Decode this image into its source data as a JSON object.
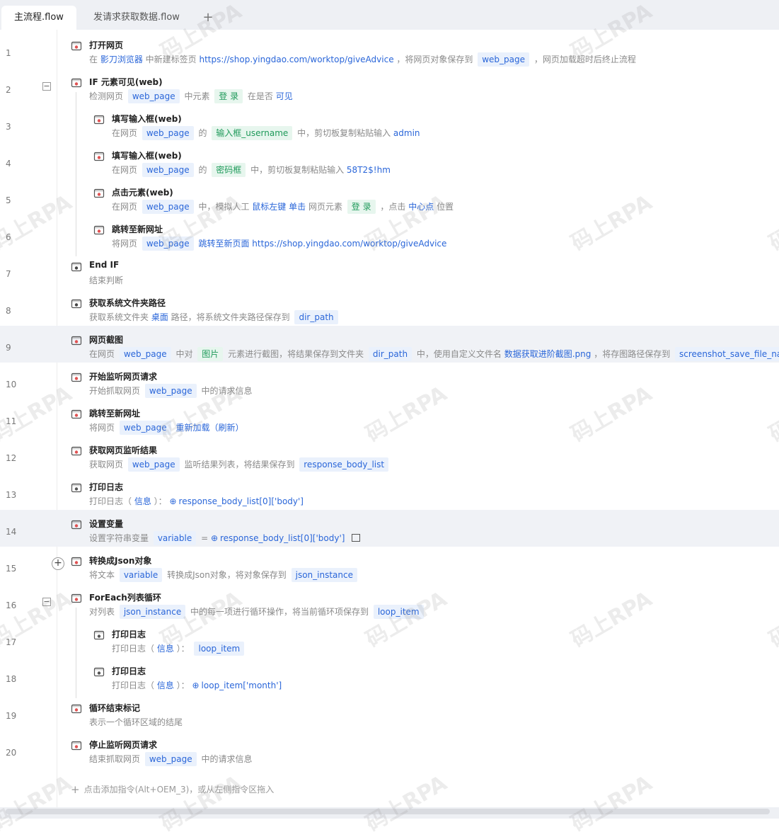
{
  "tabs": [
    {
      "label": "主流程.flow",
      "active": true
    },
    {
      "label": "发请求获取数据.flow",
      "active": false
    }
  ],
  "tab_add": "+",
  "rows": [
    {
      "num": "1",
      "title": "打开网页",
      "desc": [
        {
          "t": "在 "
        },
        {
          "v": "影刀浏览器"
        },
        {
          "t": " 中新建标签页 "
        },
        {
          "v": "https://shop.yingdao.com/worktop/giveAdvice"
        },
        {
          "t": " ，将网页对象保存到 "
        },
        {
          "pill": "web_page"
        },
        {
          "t": " ，网页加载超时后终止流程"
        }
      ]
    },
    {
      "num": "2",
      "title": "IF 元素可见(web)",
      "desc": [
        {
          "t": "检测网页 "
        },
        {
          "pill": "web_page"
        },
        {
          "t": " 中元素 "
        },
        {
          "pillg": "登 录"
        },
        {
          "t": " 在是否 "
        },
        {
          "v": "可见"
        }
      ]
    },
    {
      "num": "3",
      "title": "填写输入框(web)",
      "desc": [
        {
          "t": "在网页 "
        },
        {
          "pill": "web_page"
        },
        {
          "t": " 的 "
        },
        {
          "pillg": "输入框_username"
        },
        {
          "t": " 中，剪切板复制粘贴输入 "
        },
        {
          "v": "admin"
        }
      ]
    },
    {
      "num": "4",
      "title": "填写输入框(web)",
      "desc": [
        {
          "t": "在网页 "
        },
        {
          "pill": "web_page"
        },
        {
          "t": " 的 "
        },
        {
          "pillg": "密码框"
        },
        {
          "t": " 中，剪切板复制粘贴输入 "
        },
        {
          "v": "58T2$!hm"
        }
      ]
    },
    {
      "num": "5",
      "title": "点击元素(web)",
      "desc": [
        {
          "t": "在网页 "
        },
        {
          "pill": "web_page"
        },
        {
          "t": " 中，模拟人工 "
        },
        {
          "v": "鼠标左键"
        },
        {
          "t": " "
        },
        {
          "v": "单击"
        },
        {
          "t": " 网页元素 "
        },
        {
          "pillg": "登 录"
        },
        {
          "t": " ，点击 "
        },
        {
          "v": "中心点"
        },
        {
          "t": " 位置"
        }
      ]
    },
    {
      "num": "6",
      "title": "跳转至新网址",
      "desc": [
        {
          "t": "将网页 "
        },
        {
          "pill": "web_page"
        },
        {
          "t": " "
        },
        {
          "v": "跳转至新页面"
        },
        {
          "t": " "
        },
        {
          "v": "https://shop.yingdao.com/worktop/giveAdvice"
        }
      ]
    },
    {
      "num": "7",
      "title": "End IF",
      "desc": [
        {
          "t": "结束判断"
        }
      ]
    },
    {
      "num": "8",
      "title": "获取系统文件夹路径",
      "desc": [
        {
          "t": "获取系统文件夹 "
        },
        {
          "v": "桌面"
        },
        {
          "t": " 路径，将系统文件夹路径保存到 "
        },
        {
          "pill": "dir_path"
        }
      ]
    },
    {
      "num": "9",
      "title": "网页截图",
      "desc": [
        {
          "t": "在网页 "
        },
        {
          "pill": "web_page"
        },
        {
          "t": " 中对 "
        },
        {
          "pillg": "图片"
        },
        {
          "t": " 元素进行截图，将结果保存到文件夹 "
        },
        {
          "pill": "dir_path"
        },
        {
          "t": " 中，使用自定义文件名 "
        },
        {
          "v": "数据获取进阶截图.png"
        },
        {
          "t": " ，将存图路径保存到 "
        },
        {
          "pill": "screenshot_save_file_name"
        }
      ]
    },
    {
      "num": "10",
      "title": "开始监听网页请求",
      "desc": [
        {
          "t": "开始抓取网页 "
        },
        {
          "pill": "web_page"
        },
        {
          "t": " 中的请求信息"
        }
      ]
    },
    {
      "num": "11",
      "title": "跳转至新网址",
      "desc": [
        {
          "t": "将网页 "
        },
        {
          "pill": "web_page"
        },
        {
          "t": " "
        },
        {
          "v": "重新加载（刷新）"
        }
      ]
    },
    {
      "num": "12",
      "title": "获取网页监听结果",
      "desc": [
        {
          "t": "获取网页 "
        },
        {
          "pill": "web_page"
        },
        {
          "t": " 监听结果列表，将结果保存到 "
        },
        {
          "pill": "response_body_list"
        }
      ]
    },
    {
      "num": "13",
      "title": "打印日志",
      "desc": [
        {
          "t": "打印日志（ "
        },
        {
          "v": "信息"
        },
        {
          "t": " ）： "
        },
        {
          "expr": "response_body_list[0]['body']"
        }
      ]
    },
    {
      "num": "14",
      "title": "设置变量",
      "desc": [
        {
          "t": "设置字符串变量 "
        },
        {
          "pill": "variable"
        },
        {
          "t": " = "
        },
        {
          "expr": "response_body_list[0]['body']"
        },
        {
          "memo": ""
        }
      ]
    },
    {
      "num": "15",
      "title": "转换成Json对象",
      "desc": [
        {
          "t": "将文本 "
        },
        {
          "pill": "variable"
        },
        {
          "t": " 转换成Json对象，将对象保存到 "
        },
        {
          "pill": "json_instance"
        }
      ]
    },
    {
      "num": "16",
      "title": "ForEach列表循环",
      "desc": [
        {
          "t": "对列表 "
        },
        {
          "pill": "json_instance"
        },
        {
          "t": " 中的每一项进行循环操作，将当前循环项保存到 "
        },
        {
          "pill": "loop_item"
        }
      ]
    },
    {
      "num": "17",
      "title": "打印日志",
      "desc": [
        {
          "t": "打印日志（ "
        },
        {
          "v": "信息"
        },
        {
          "t": " ）： "
        },
        {
          "pill": "loop_item"
        }
      ]
    },
    {
      "num": "18",
      "title": "打印日志",
      "desc": [
        {
          "t": "打印日志（ "
        },
        {
          "v": "信息"
        },
        {
          "t": " ）： "
        },
        {
          "expr": "loop_item['month']"
        }
      ]
    },
    {
      "num": "19",
      "title": "循环结束标记",
      "desc": [
        {
          "t": "表示一个循环区域的结尾"
        }
      ]
    },
    {
      "num": "20",
      "title": "停止监听网页请求",
      "desc": [
        {
          "t": "结束抓取网页 "
        },
        {
          "pill": "web_page"
        },
        {
          "t": " 中的请求信息"
        }
      ]
    }
  ],
  "add_command": "点击添加指令(Alt+OEM_3)，或从左侧指令区拖入",
  "watermark": "码上RPA"
}
